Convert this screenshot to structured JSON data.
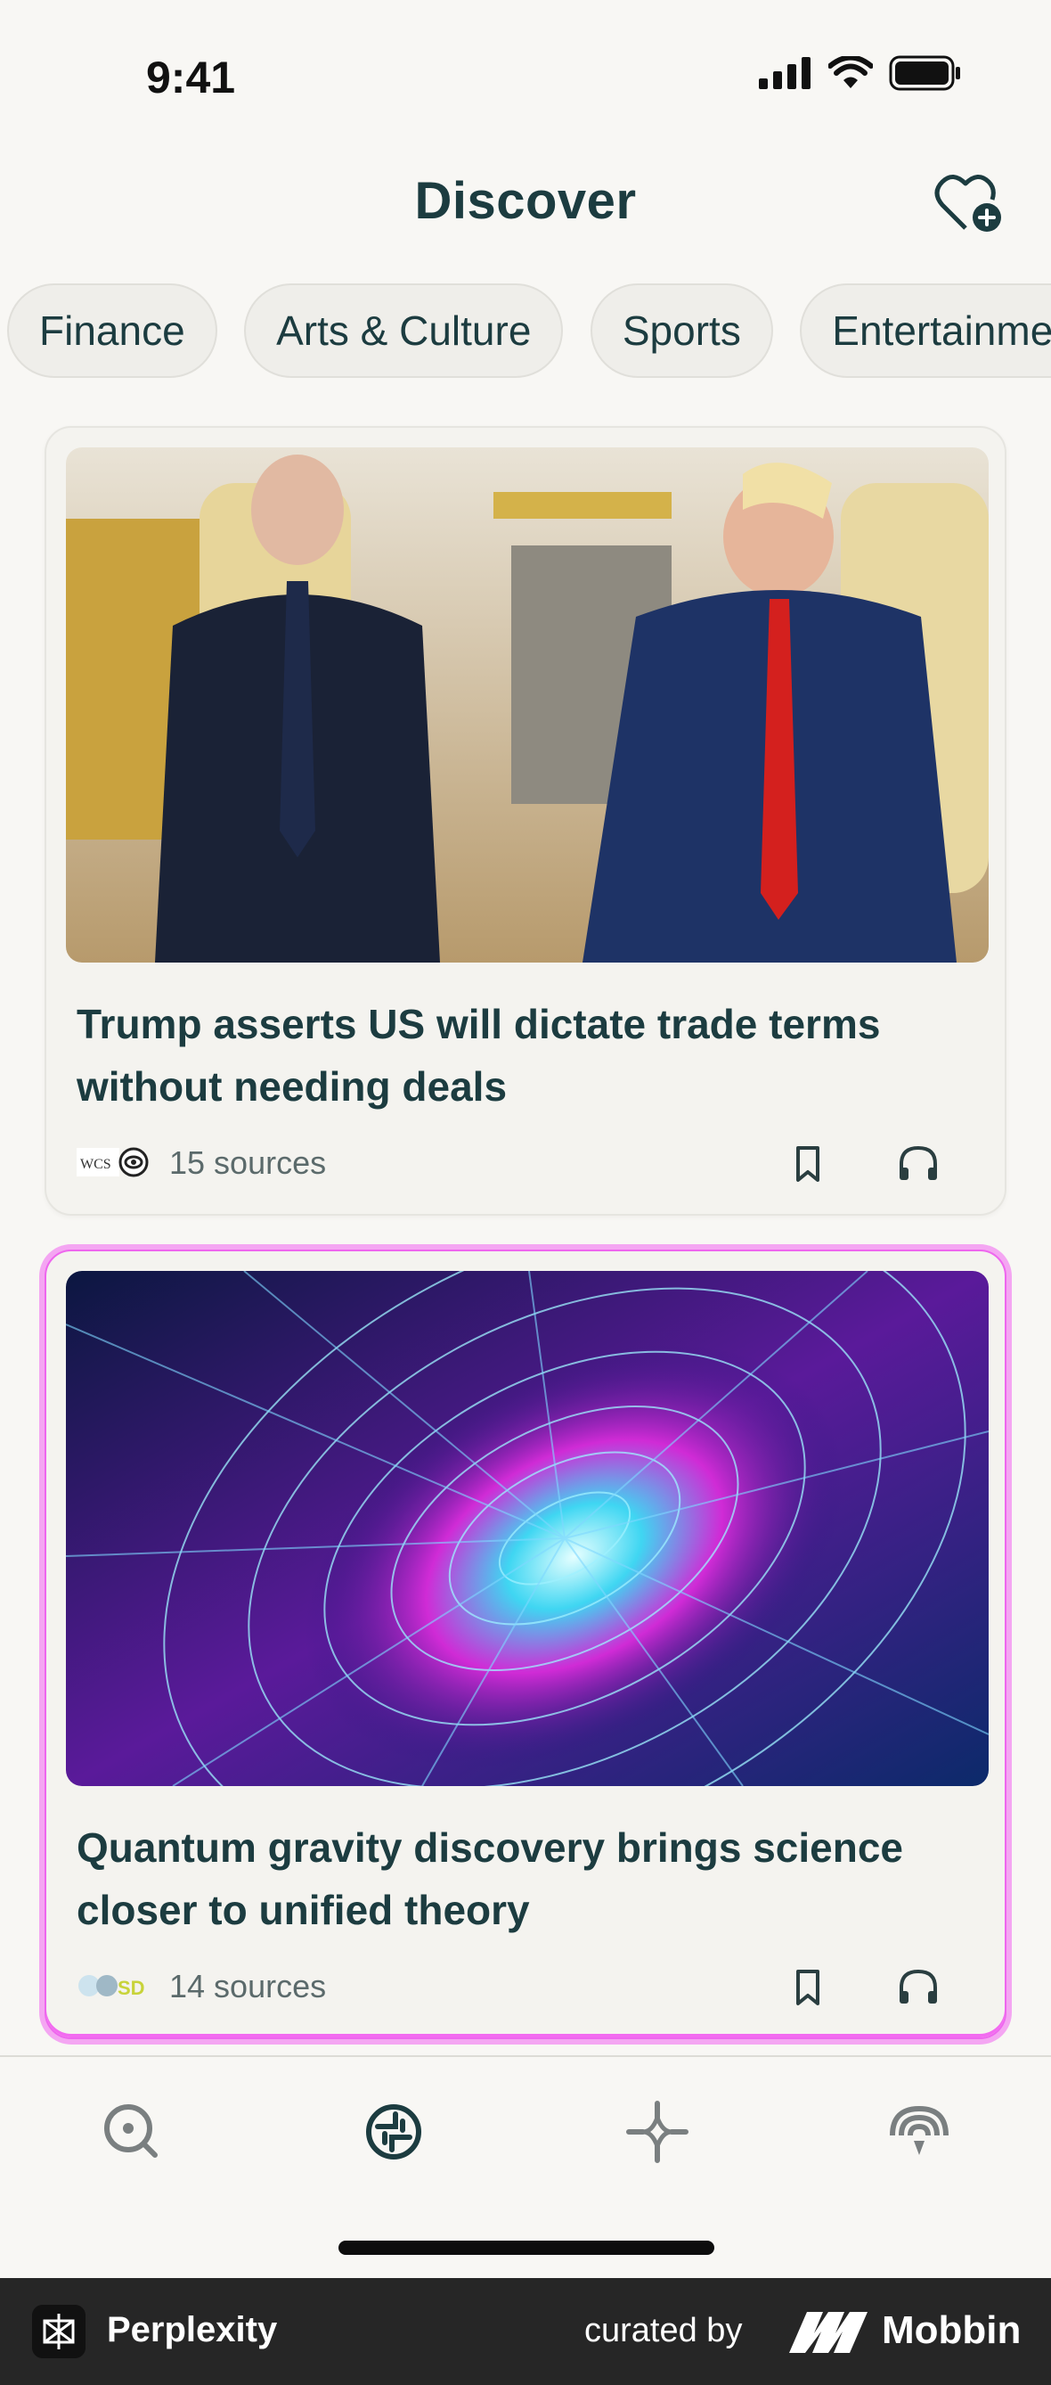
{
  "status_bar": {
    "time": "9:41"
  },
  "header": {
    "title": "Discover"
  },
  "chips": [
    "Finance",
    "Arts & Culture",
    "Sports",
    "Entertainment"
  ],
  "cards": [
    {
      "title": "Trump asserts US will dictate trade terms without needing deals",
      "sources": "15 sources"
    },
    {
      "title": "Quantum gravity discovery brings science closer to unified theory",
      "sources": "14 sources"
    }
  ],
  "tabs": [
    "search-icon",
    "discover-icon",
    "spaces-icon",
    "library-icon"
  ],
  "footer": {
    "app": "Perplexity",
    "curated": "curated by",
    "brand": "Mobbin"
  },
  "colors": {
    "accent": "#1c3c40",
    "glow": "#ee66ee",
    "background": "#f8f7f4"
  }
}
